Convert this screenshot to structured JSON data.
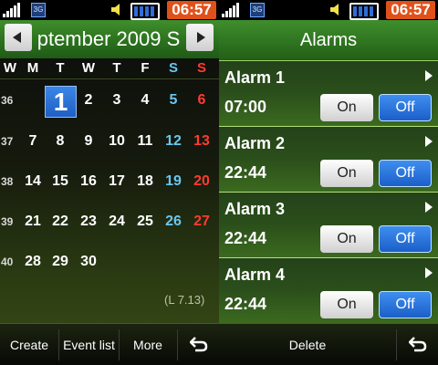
{
  "status": {
    "clock": "06:57",
    "network_label": "3G"
  },
  "calendar": {
    "month_title": "ptember 2009 S",
    "weekdays": [
      {
        "label": "W",
        "color": "#ffffff"
      },
      {
        "label": "M",
        "color": "#ffffff"
      },
      {
        "label": "T",
        "color": "#ffffff"
      },
      {
        "label": "W",
        "color": "#ffffff"
      },
      {
        "label": "T",
        "color": "#ffffff"
      },
      {
        "label": "F",
        "color": "#ffffff"
      },
      {
        "label": "S",
        "color": "#69c7ef"
      },
      {
        "label": "S",
        "color": "#ff3b30"
      }
    ],
    "weeks": [
      {
        "num": "36",
        "days": [
          "",
          "1",
          "2",
          "3",
          "4",
          "5",
          "6"
        ]
      },
      {
        "num": "37",
        "days": [
          "7",
          "8",
          "9",
          "10",
          "11",
          "12",
          "13"
        ]
      },
      {
        "num": "38",
        "days": [
          "14",
          "15",
          "16",
          "17",
          "18",
          "19",
          "20"
        ]
      },
      {
        "num": "39",
        "days": [
          "21",
          "22",
          "23",
          "24",
          "25",
          "26",
          "27"
        ]
      },
      {
        "num": "40",
        "days": [
          "28",
          "29",
          "30",
          "",
          "",
          "",
          ""
        ]
      }
    ],
    "today": "1",
    "lunar_note": "(L 7.13)",
    "saturday_color": "#69c7ef",
    "sunday_color": "#ff3b30",
    "today_color": "#1f5fc4"
  },
  "left_softkeys": {
    "create": "Create",
    "event_list": "Event list",
    "more": "More"
  },
  "alarms": {
    "title": "Alarms",
    "items": [
      {
        "name": "Alarm 1",
        "time": "07:00",
        "on": "On",
        "off": "Off"
      },
      {
        "name": "Alarm 2",
        "time": "22:44",
        "on": "On",
        "off": "Off"
      },
      {
        "name": "Alarm 3",
        "time": "22:44",
        "on": "On",
        "off": "Off"
      },
      {
        "name": "Alarm 4",
        "time": "22:44",
        "on": "On",
        "off": "Off"
      }
    ],
    "delete_label": "Delete",
    "accent_color": "#1b5fc9"
  }
}
